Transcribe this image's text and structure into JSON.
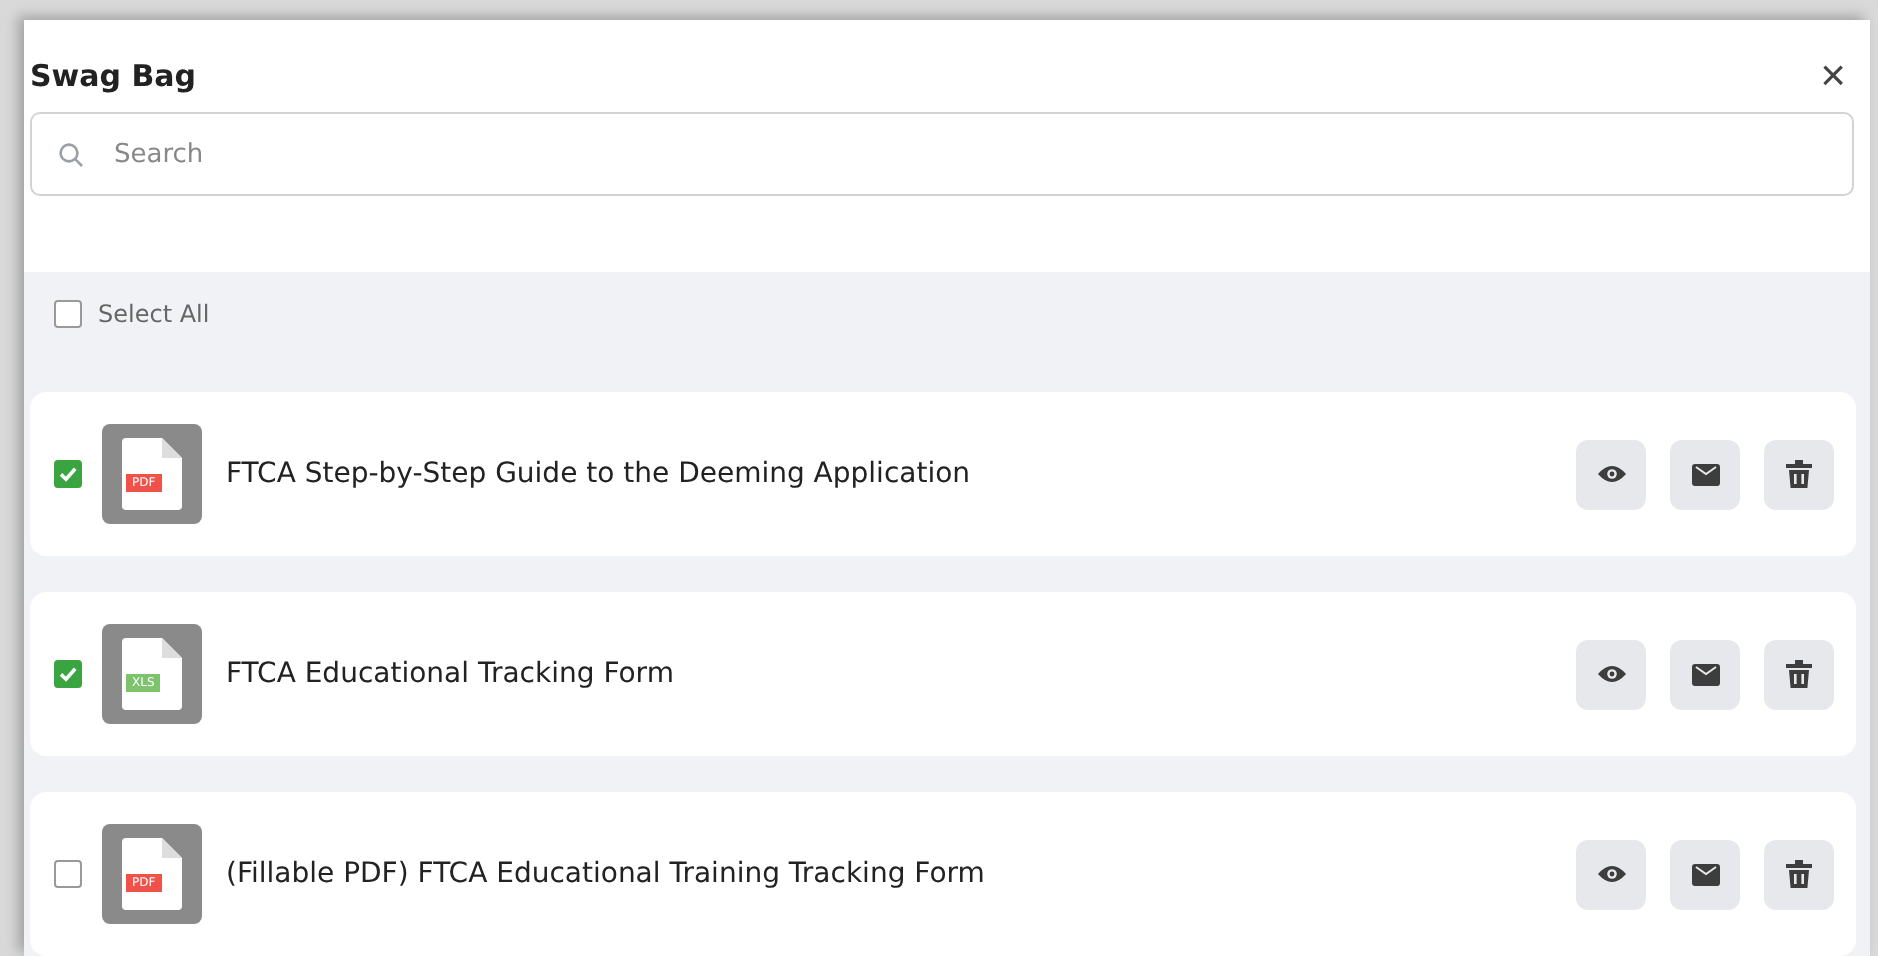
{
  "dialog": {
    "title": "Swag Bag",
    "close": "×"
  },
  "search": {
    "placeholder": "Search"
  },
  "select_all": {
    "label": "Select All",
    "checked": false
  },
  "items": [
    {
      "title": "FTCA Step-by-Step Guide to the Deeming Application",
      "file_type": "PDF",
      "kind": "pdf",
      "checked": true
    },
    {
      "title": "FTCA Educational Tracking Form",
      "file_type": "XLS",
      "kind": "xls",
      "checked": true
    },
    {
      "title": "(Fillable PDF) FTCA Educational Training Tracking Form",
      "file_type": "PDF",
      "kind": "pdf",
      "checked": false
    }
  ]
}
